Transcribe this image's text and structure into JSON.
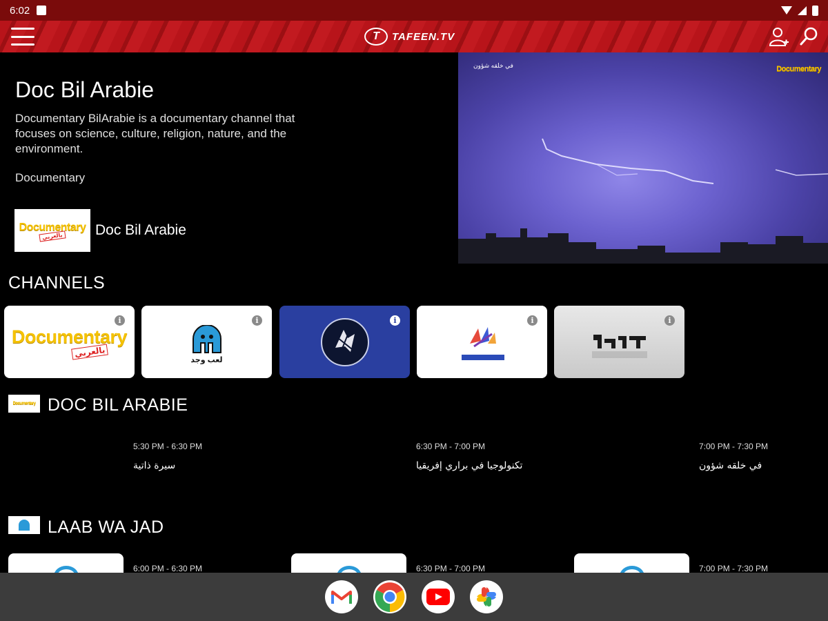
{
  "status_bar": {
    "time": "6:02"
  },
  "app_bar": {
    "logo_text": "TAFEEN.TV",
    "logo_mark": "T"
  },
  "hero": {
    "title": "Doc Bil Arabie",
    "description": "Documentary BilArabie is a documentary channel that focuses on science, culture, religion, nature, and the environment.",
    "genre": "Documentary",
    "channel_name": "Doc Bil Arabie",
    "logo_word": "Documentary",
    "logo_stamp": "بالعربي"
  },
  "video": {
    "caption": "في خلقه شؤون",
    "badge_word": "Documentary"
  },
  "channels": {
    "title": "CHANNELS",
    "cards": [
      {
        "name": "Documentary",
        "stamp": "بالعربي"
      },
      {
        "name": "لعب وجد"
      },
      {
        "name": ""
      },
      {
        "name": ""
      },
      {
        "name": ""
      }
    ]
  },
  "rows": [
    {
      "title": "DOC BIL ARABIE",
      "programs": [
        {
          "time": "5:30 PM - 6:30 PM",
          "title": "سيرة ذاتية"
        },
        {
          "time": "6:30 PM - 7:00 PM",
          "title": "تكنولوجيا في براري إفريقيا"
        },
        {
          "time": "7:00 PM - 7:30 PM",
          "title": "في خلقه شؤون"
        }
      ]
    },
    {
      "title": "LAAB WA JAD",
      "programs": [
        {
          "time": "6:00 PM - 6:30 PM"
        },
        {
          "time": "6:30 PM - 7:00 PM"
        },
        {
          "time": "7:00 PM - 7:30 PM"
        }
      ]
    }
  ],
  "dock": {
    "apps": [
      "gmail-icon",
      "chrome-icon",
      "youtube-icon",
      "photos-icon"
    ]
  }
}
